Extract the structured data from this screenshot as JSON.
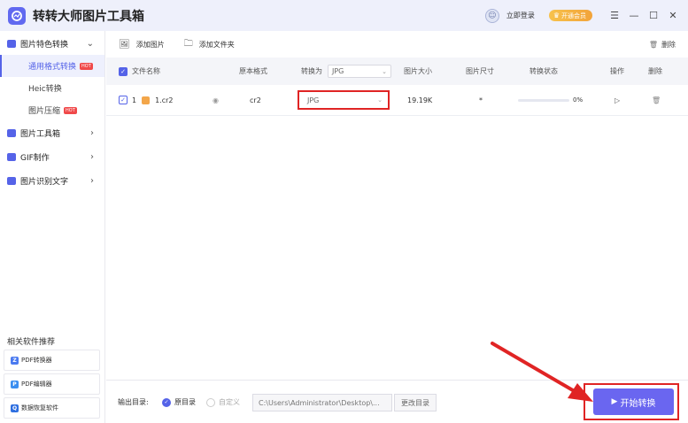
{
  "app": {
    "title": "转转大师图片工具箱",
    "login": "立即登录",
    "vip": "开通会员"
  },
  "sidebar": {
    "group1": {
      "label": "图片特色转换"
    },
    "sub": [
      {
        "label": "通用格式转换",
        "badge": "HOT"
      },
      {
        "label": "Heic转换"
      },
      {
        "label": "图片压缩",
        "badge": "HOT"
      }
    ],
    "group2": {
      "label": "图片工具箱"
    },
    "group3": {
      "label": "GIF制作"
    },
    "group4": {
      "label": "图片识别文字"
    },
    "related_title": "相关软件推荐",
    "related": [
      {
        "label": "PDF转换器"
      },
      {
        "label": "PDF编辑器"
      },
      {
        "label": "数据恢复软件"
      }
    ]
  },
  "toolbar": {
    "add_image": "添加图片",
    "add_folder": "添加文件夹",
    "clear": "删除"
  },
  "table": {
    "headers": {
      "name": "文件名称",
      "orig_format": "原本格式",
      "convert_to": "转换为",
      "convert_to_value": "JPG",
      "size": "图片大小",
      "dimensions": "图片尺寸",
      "status": "转换状态",
      "action": "操作",
      "delete": "删除"
    },
    "rows": [
      {
        "index": "1",
        "name": "1.cr2",
        "orig_format": "cr2",
        "target": "JPG",
        "size": "19.19K",
        "dimensions": "*",
        "progress": "0%"
      }
    ]
  },
  "bottom": {
    "output_label": "输出目录:",
    "opt_original": "原目录",
    "opt_custom": "自定义",
    "path": "C:\\Users\\Administrator\\Desktop\\...",
    "change_dir": "更改目录",
    "start": "开始转换"
  },
  "colors": {
    "accent": "#5563e8",
    "annotation": "#e02424",
    "start_button": "#6a66f0"
  }
}
